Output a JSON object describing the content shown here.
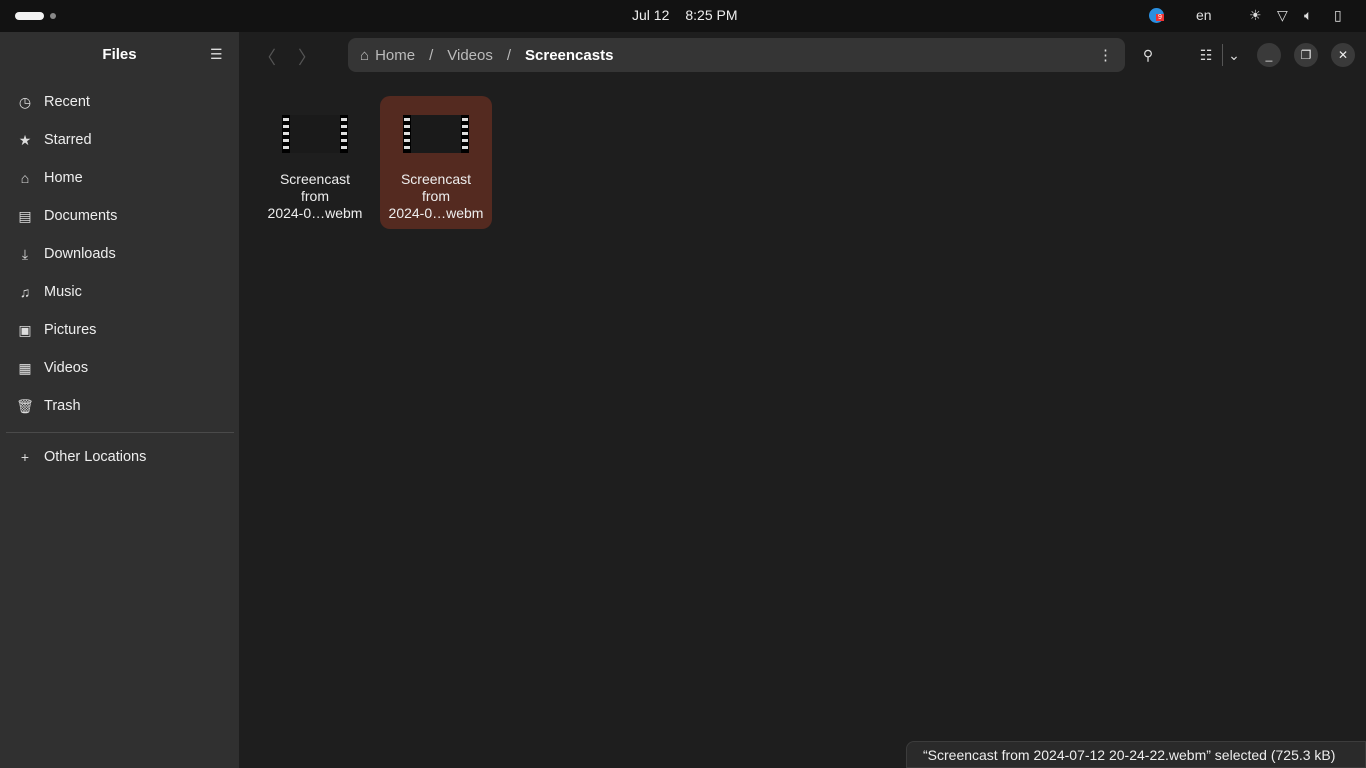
{
  "topbar": {
    "date": "Jul 12",
    "time": "8:25 PM",
    "lang": "en",
    "badge": "9"
  },
  "sidebar": {
    "title": "Files",
    "items": [
      {
        "label": "Recent",
        "icon": "clock-icon"
      },
      {
        "label": "Starred",
        "icon": "star-icon"
      },
      {
        "label": "Home",
        "icon": "home-icon"
      },
      {
        "label": "Documents",
        "icon": "document-icon"
      },
      {
        "label": "Downloads",
        "icon": "download-icon"
      },
      {
        "label": "Music",
        "icon": "music-icon"
      },
      {
        "label": "Pictures",
        "icon": "picture-icon"
      },
      {
        "label": "Videos",
        "icon": "video-icon"
      },
      {
        "label": "Trash",
        "icon": "trash-icon"
      }
    ],
    "other": "Other Locations"
  },
  "path": {
    "items": [
      "Home",
      "Videos",
      "Screencasts"
    ]
  },
  "files": [
    {
      "name": "Screencast from 2024-0…webm",
      "l1": "Screencast",
      "l2": "from",
      "l3": "2024-0…webm",
      "selected": false
    },
    {
      "name": "Screencast from 2024-0…webm",
      "l1": "Screencast",
      "l2": "from",
      "l3": "2024-0…webm",
      "selected": true
    }
  ],
  "status": "“Screencast from 2024-07-12 20-24-22.webm” selected  (725.3 kB)",
  "colors": {
    "selection": "#542a20",
    "sidebar": "#303030"
  }
}
